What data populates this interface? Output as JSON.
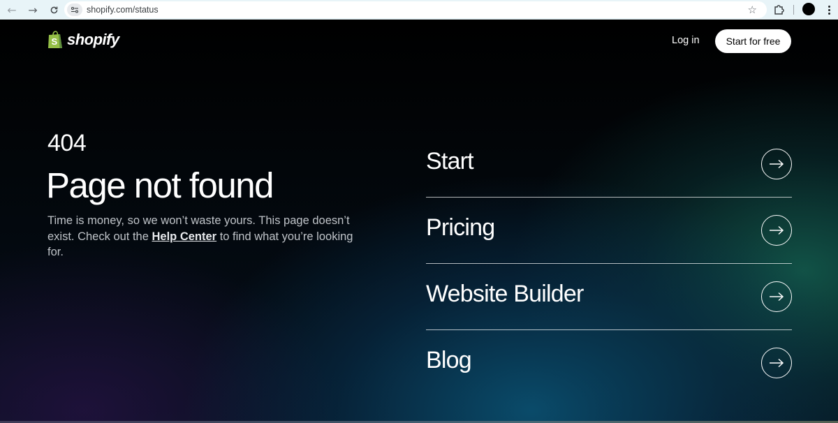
{
  "browser": {
    "url": "shopify.com/status"
  },
  "header": {
    "logo_text": "shopify",
    "login_label": "Log in",
    "cta_label": "Start for free"
  },
  "error": {
    "code": "404",
    "title": "Page not found",
    "description_before": "Time is money, so we won’t waste yours. This page doesn’t exist. Check out the ",
    "help_link": "Help Center",
    "description_after": " to find what you’re looking for."
  },
  "nav_links": [
    {
      "label": "Start"
    },
    {
      "label": "Pricing"
    },
    {
      "label": "Website Builder"
    },
    {
      "label": "Blog"
    }
  ],
  "colors": {
    "brand_green": "#95bf47",
    "background": "#000000",
    "text_primary": "#ffffff",
    "text_secondary": "#bfc3c8"
  }
}
